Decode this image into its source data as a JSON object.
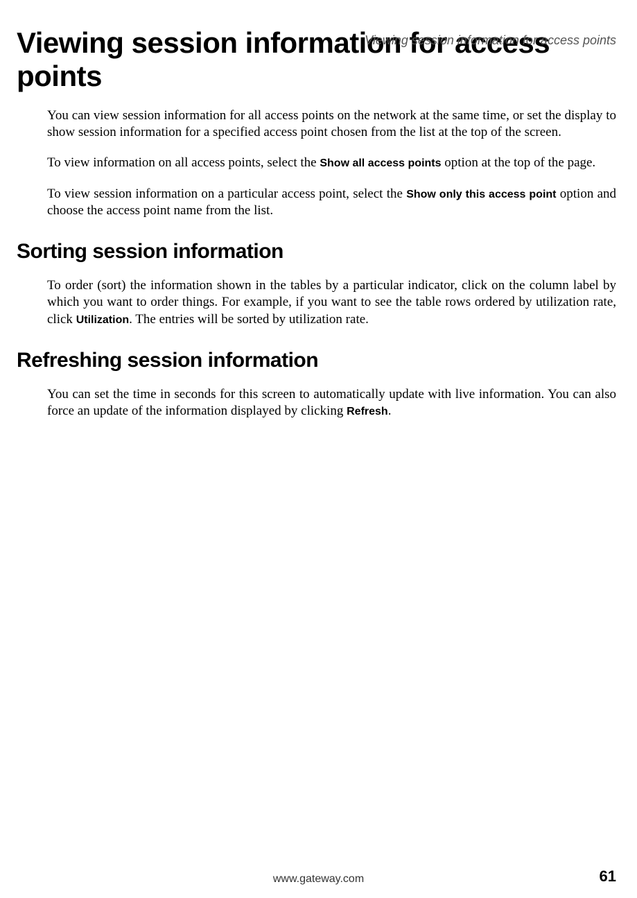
{
  "header": {
    "running_title": "Viewing session information for access points"
  },
  "main": {
    "title": "Viewing session information for access points",
    "para1_a": "You can view session information for all access points on the network at the same time, or set the display to show session information for a specified access point chosen from the list at the top of the screen.",
    "para2_a": "To view information on all access points, select the ",
    "para2_bold": "Show all access points",
    "para2_c": " option at the top of the page.",
    "para3_a": "To view session information on a particular access point, select the ",
    "para3_bold": "Show only this access point",
    "para3_c": " option and choose the access point name from the list."
  },
  "section_sorting": {
    "title": "Sorting session information",
    "para_a": "To order (sort) the information shown in the tables by a particular indicator, click on the column label by which you want to order things. For example, if you want to see the table rows ordered by utilization rate, click ",
    "para_bold": "Utilization",
    "para_c": ". The entries will be sorted by utilization rate."
  },
  "section_refreshing": {
    "title": "Refreshing session information",
    "para_a": "You can set the time in seconds for this screen to automatically update with live information. You can also force an update of the information displayed by clicking ",
    "para_bold": "Refresh",
    "para_c": "."
  },
  "footer": {
    "url": "www.gateway.com",
    "page_number": "61"
  }
}
